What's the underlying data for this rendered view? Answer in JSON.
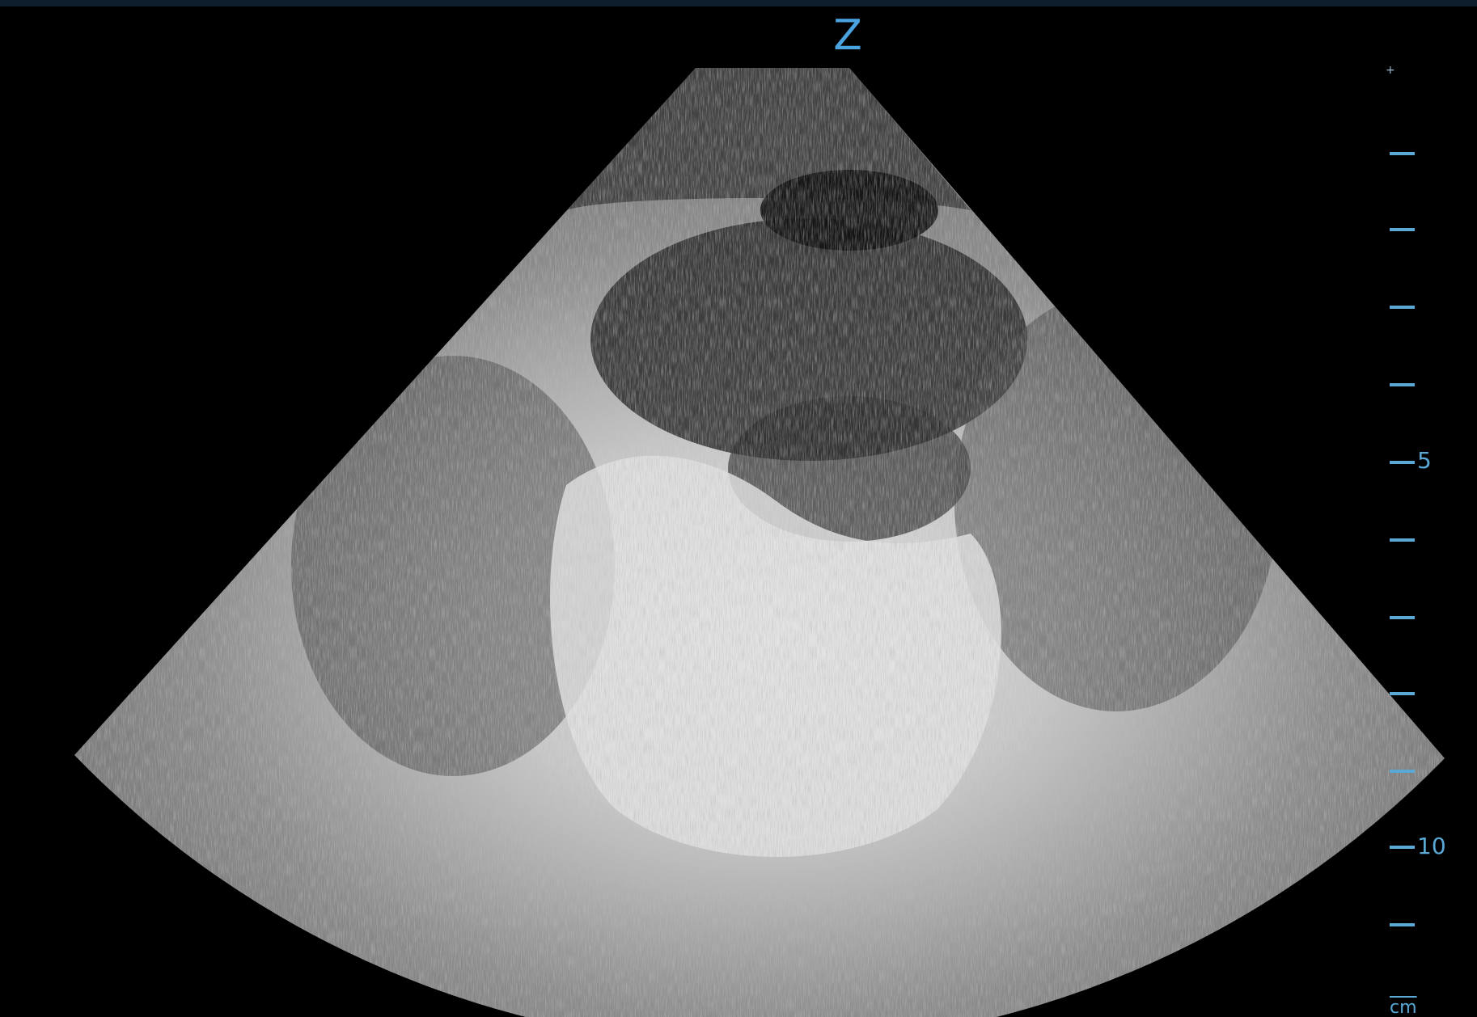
{
  "orientation_marker": "Z",
  "colors": {
    "background": "#000000",
    "scale_accent": "#5aa8d6",
    "marker": "#4aa3df"
  },
  "depth_scale": {
    "unit": "cm",
    "labels": {
      "5": "5",
      "10": "10"
    },
    "ticks_cm": [
      1,
      2,
      3,
      4,
      5,
      6,
      7,
      8,
      9,
      10,
      11,
      12
    ]
  },
  "focus_marker": "+",
  "image_content": {
    "type": "ultrasound-sector",
    "description_icon": "ultrasound-scan-icon"
  }
}
